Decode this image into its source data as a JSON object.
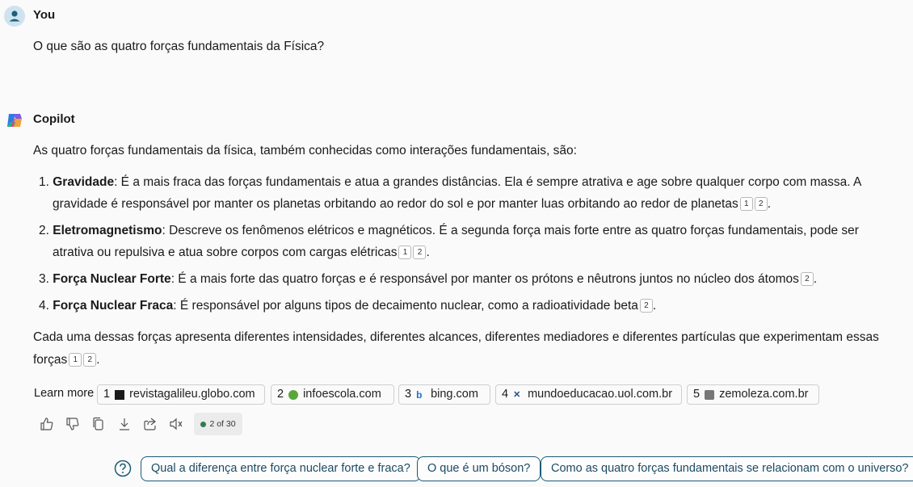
{
  "user": {
    "name": "You",
    "message": "O que são as quatro forças fundamentais da Física?"
  },
  "copilot": {
    "name": "Copilot",
    "intro": "As quatro forças fundamentais da física, também conhecidas como interações fundamentais, são:",
    "items": [
      {
        "num": "1.",
        "title": "Gravidade",
        "text_line1": ": É a mais fraca das forças fundamentais e atua a grandes distâncias. Ela é sempre atrativa e age sobre qualquer corpo com massa. A",
        "text_line2": "gravidade é responsável por manter os planetas orbitando ao redor do sol e por manter luas orbitando ao redor de planetas",
        "cites": [
          "1",
          "2"
        ],
        "end": "."
      },
      {
        "num": "2.",
        "title": "Eletromagnetismo",
        "text_line1": ": Descreve os fenômenos elétricos e magnéticos. É a segunda força mais forte entre as quatro forças fundamentais, pode ser",
        "text_line2": "atrativa ou repulsiva e atua sobre corpos com cargas elétricas",
        "cites": [
          "1",
          "2"
        ],
        "end": "."
      },
      {
        "num": "3.",
        "title": "Força Nuclear Forte",
        "text_line1": ": É a mais forte das quatro forças e é responsável por manter os prótons e nêutrons juntos no núcleo dos átomos",
        "cites": [
          "2"
        ],
        "end": "."
      },
      {
        "num": "4.",
        "title": "Força Nuclear Fraca",
        "text_line1": ": É responsável por alguns tipos de decaimento nuclear, como a radioatividade beta",
        "cites": [
          "2"
        ],
        "end": "."
      }
    ],
    "summary_line1": "Cada uma dessas forças apresenta diferentes intensidades, diferentes alcances, diferentes mediadores e diferentes partículas que experimentam essas",
    "summary_line2": "forças",
    "summary_cites": [
      "1",
      "2"
    ],
    "summary_end": "."
  },
  "learn_more": {
    "label": "Learn more",
    "sources": [
      {
        "idx": "1",
        "domain": "revistagalileu.globo.com",
        "icon": "galileu-favicon"
      },
      {
        "idx": "2",
        "domain": "infoescola.com",
        "icon": "infoescola-favicon"
      },
      {
        "idx": "3",
        "domain": "bing.com",
        "icon": "bing-favicon"
      },
      {
        "idx": "4",
        "domain": "mundoeducacao.uol.com.br",
        "icon": "mundoeducacao-favicon"
      },
      {
        "idx": "5",
        "domain": "zemoleza.com.br",
        "icon": "zemoleza-favicon"
      }
    ]
  },
  "actions": {
    "icons": [
      "thumbs-up-icon",
      "thumbs-down-icon",
      "copy-icon",
      "download-icon",
      "share-icon",
      "read-aloud-icon"
    ],
    "counter": "2 of 30",
    "counter_dot_color": "#2e7d4f"
  },
  "suggestions": {
    "icon": "question-icon",
    "items": [
      "Qual a diferença entre força nuclear forte e fraca?",
      "O que é um bóson?",
      "Como as quatro forças fundamentais se relacionam com o universo?"
    ]
  },
  "colors": {
    "accent": "#1b5a73",
    "background": "#fafafa"
  }
}
